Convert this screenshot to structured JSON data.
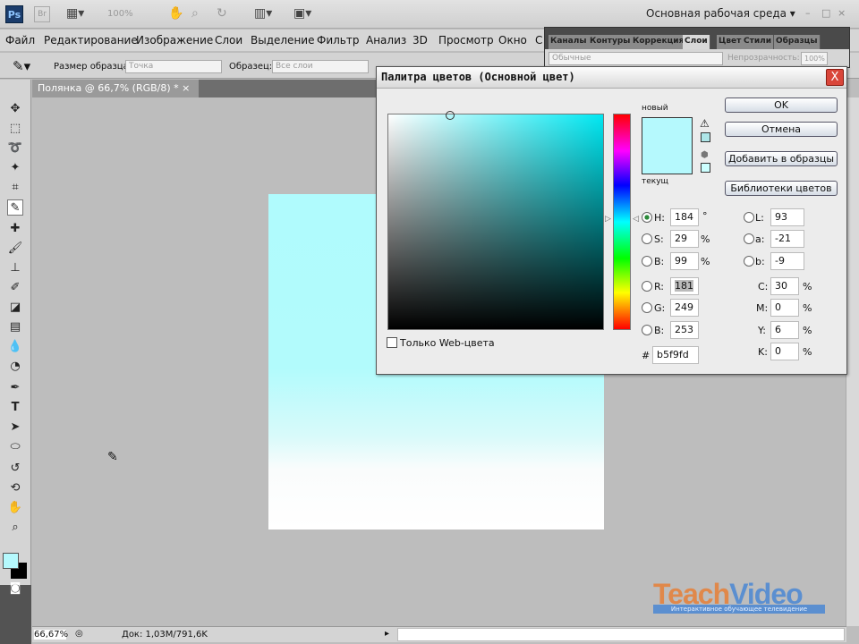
{
  "appbar": {
    "ps_logo": "Ps",
    "br_logo": "Br",
    "zoom": "100%",
    "workspace": "Основная рабочая среда"
  },
  "menu": [
    "Файл",
    "Редактирование",
    "Изображение",
    "Слои",
    "Выделение",
    "Фильтр",
    "Анализ",
    "3D",
    "Просмотр",
    "Окно",
    "С"
  ],
  "options": {
    "sample_size_label": "Размер образца:",
    "sample_size_value": "Точка",
    "sample_label": "Образец:",
    "sample_value": "Все слои"
  },
  "panel": {
    "tabs": [
      "Каналы",
      "Контуры",
      "Коррекция",
      "Слои",
      "Цвет",
      "Стили",
      "Образцы"
    ],
    "active_tab": "Слои",
    "blend_mode": "Обычные",
    "opacity_label": "Непрозрачность:",
    "opacity_value": "100%"
  },
  "document": {
    "tab_title": "Полянка @ 66,7% (RGB/8) *",
    "close": "×"
  },
  "status": {
    "zoom": "66,67%",
    "doc_info": "Док: 1,03M/791,6K"
  },
  "dialog": {
    "title": "Палитра цветов (Основной цвет)",
    "close": "X",
    "ok": "OK",
    "cancel": "Отмена",
    "add_swatches": "Добавить в образцы",
    "color_libraries": "Библиотеки цветов",
    "new_label": "новый",
    "current_label": "текущ",
    "new_color": "#b5f9fd",
    "current_color": "#b0fbfd",
    "web_only": "Только Web-цвета",
    "hsb": [
      {
        "label": "H:",
        "value": "184",
        "unit": "°",
        "selected": true
      },
      {
        "label": "S:",
        "value": "29",
        "unit": "%"
      },
      {
        "label": "B:",
        "value": "99",
        "unit": "%"
      }
    ],
    "rgb": [
      {
        "label": "R:",
        "value": "181"
      },
      {
        "label": "G:",
        "value": "249"
      },
      {
        "label": "B:",
        "value": "253"
      }
    ],
    "lab": [
      {
        "label": "L:",
        "value": "93"
      },
      {
        "label": "a:",
        "value": "-21"
      },
      {
        "label": "b:",
        "value": "-9"
      }
    ],
    "cmyk": [
      {
        "label": "C:",
        "value": "30",
        "unit": "%"
      },
      {
        "label": "M:",
        "value": "0",
        "unit": "%"
      },
      {
        "label": "Y:",
        "value": "6",
        "unit": "%"
      },
      {
        "label": "K:",
        "value": "0",
        "unit": "%"
      }
    ],
    "hex_label": "#",
    "hex": "b5f9fd"
  },
  "watermark": {
    "teach": "Teach",
    "video": "Video",
    "subtitle": "Интерактивное обучающее телевидение"
  }
}
